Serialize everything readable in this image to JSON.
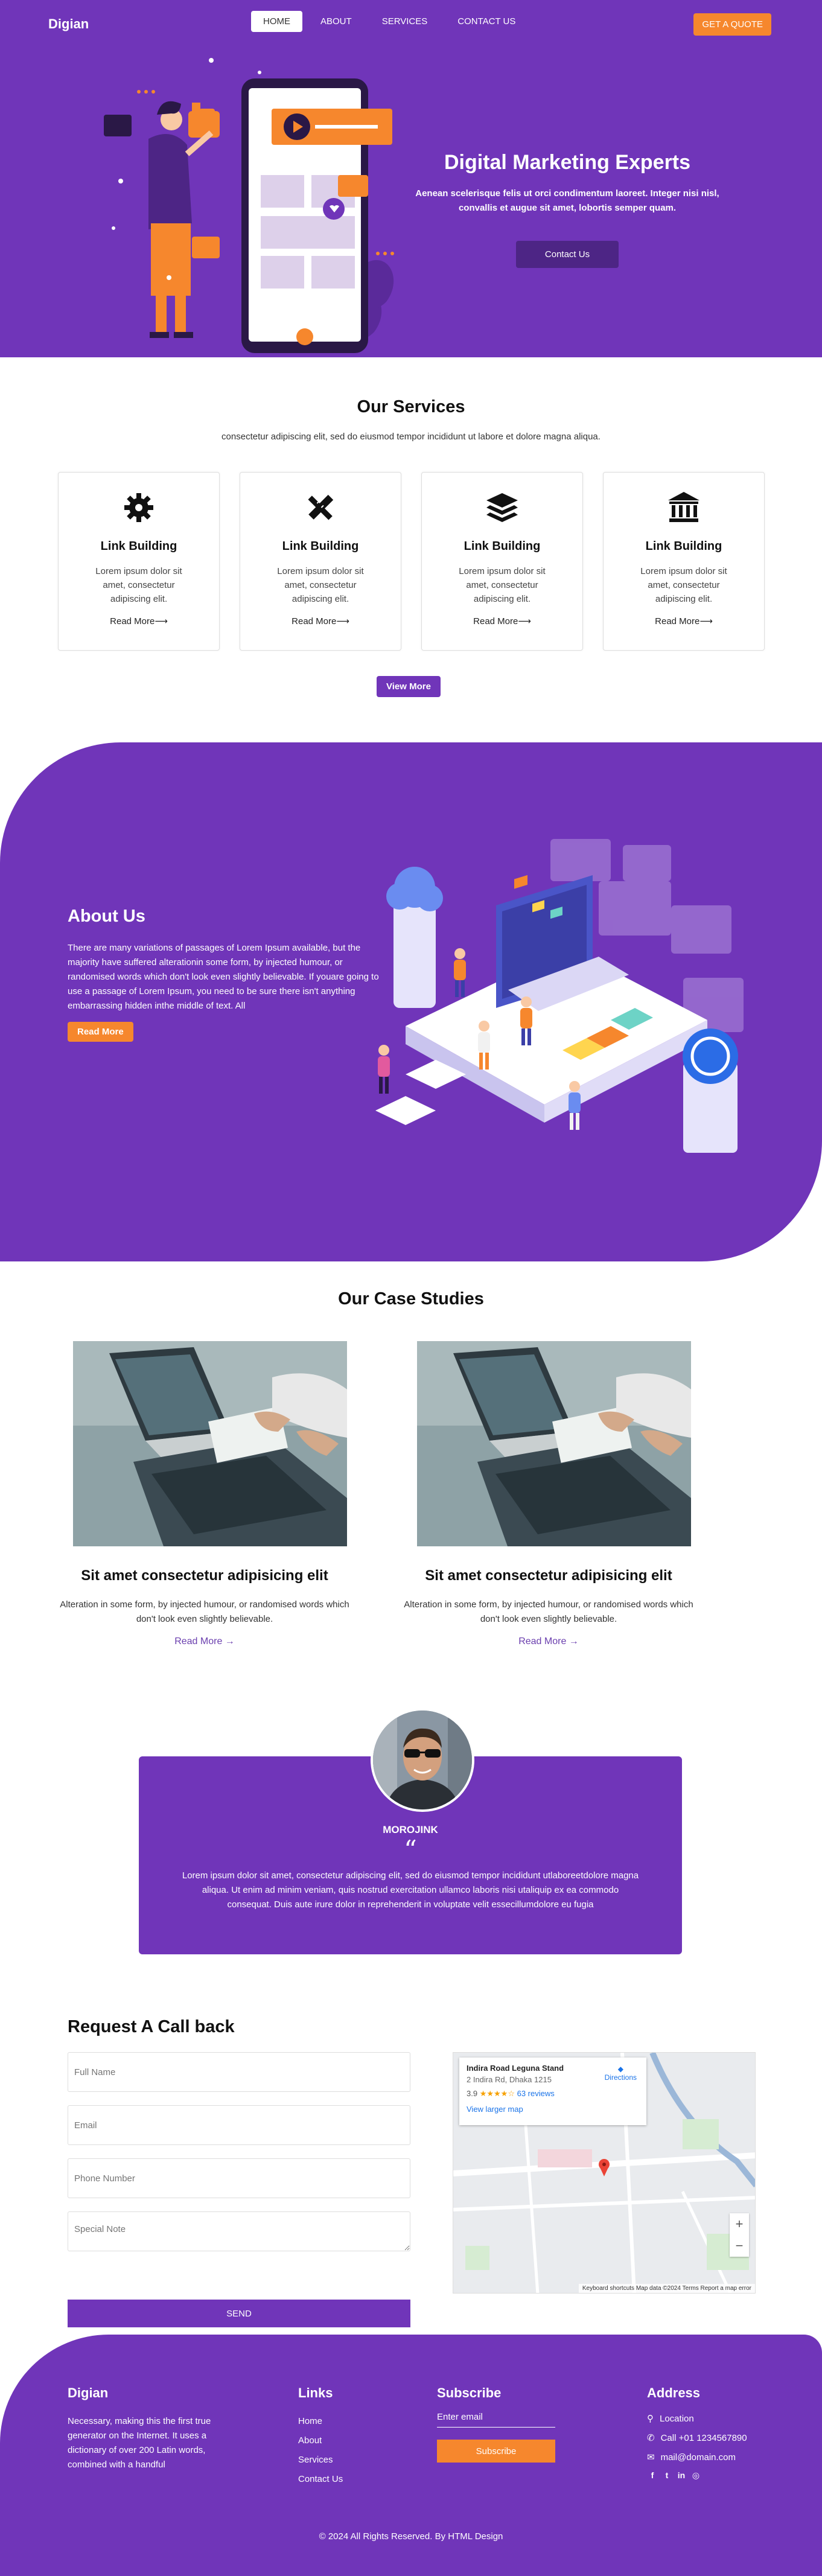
{
  "nav": {
    "brand": "Digian",
    "items": [
      "HOME",
      "ABOUT",
      "SERVICES",
      "CONTACT US"
    ],
    "active_index": 0,
    "quote_label": "GET A QUOTE"
  },
  "hero": {
    "title": "Digital Marketing Experts",
    "subtitle": "Aenean scelerisque felis ut orci condimentum laoreet. Integer nisi nisl, convallis et augue sit amet, lobortis semper quam.",
    "button": "Contact Us"
  },
  "services": {
    "title": "Our Services",
    "subtitle": "consectetur adipiscing elit, sed do eiusmod tempor incididunt ut labore et dolore magna aliqua.",
    "cards": [
      {
        "icon": "gear-icon",
        "title": "Link Building",
        "text": "Lorem ipsum dolor sit amet, consectetur adipiscing elit.",
        "more": "Read More"
      },
      {
        "icon": "pencil-ruler-icon",
        "title": "Link Building",
        "text": "Lorem ipsum dolor sit amet, consectetur adipiscing elit.",
        "more": "Read More"
      },
      {
        "icon": "layers-icon",
        "title": "Link Building",
        "text": "Lorem ipsum dolor sit amet, consectetur adipiscing elit.",
        "more": "Read More"
      },
      {
        "icon": "bank-icon",
        "title": "Link Building",
        "text": "Lorem ipsum dolor sit amet, consectetur adipiscing elit.",
        "more": "Read More"
      }
    ],
    "view_more": "View More"
  },
  "about": {
    "title": "About Us",
    "body": "There are many variations of passages of Lorem Ipsum available, but the majority have suffered alterationin some form, by injected humour, or randomised words which don't look even slightly believable. If youare going to use a passage of Lorem Ipsum, you need to be sure there isn't anything embarrassing hidden inthe middle of text. All",
    "button": "Read More"
  },
  "cases": {
    "title": "Our Case Studies",
    "items": [
      {
        "title": "Sit amet consectetur adipisicing elit",
        "text": "Alteration in some form, by injected humour, or randomised words which don't look even slightly believable.",
        "more": "Read More"
      },
      {
        "title": "Sit amet consectetur adipisicing elit",
        "text": "Alteration in some form, by injected humour, or randomised words which don't look even slightly believable.",
        "more": "Read More"
      }
    ]
  },
  "testimonial": {
    "name": "MOROJINK",
    "quote_mark": "“",
    "text": "Lorem ipsum dolor sit amet, consectetur adipiscing elit, sed do eiusmod tempor incididunt utlaboreetdolore magna aliqua. Ut enim ad minim veniam, quis nostrud exercitation ullamco laboris nisi utaliquip ex ea commodo consequat. Duis aute irure dolor in reprehenderit in voluptate velit essecillumdolore eu fugia"
  },
  "callback": {
    "title": "Request A Call back",
    "fields": {
      "name": "Full Name",
      "email": "Email",
      "phone": "Phone Number",
      "note": "Special Note"
    },
    "send": "SEND"
  },
  "map": {
    "place": "Indira Road Leguna Stand",
    "address": "2 Indira Rd, Dhaka 1215",
    "rating": "3.9",
    "stars": "★★★★☆",
    "reviews": "63 reviews",
    "larger": "View larger map",
    "directions": "Directions",
    "marker_label": "Indira Road Leguna Stand",
    "footer": "Keyboard shortcuts   Map data ©2024   Terms   Report a map error"
  },
  "footer": {
    "brand": "Digian",
    "brand_text": "Necessary, making this the first true generator on the Internet. It uses a dictionary of over 200 Latin words, combined with a handful",
    "links_title": "Links",
    "links": [
      "Home",
      "About",
      "Services",
      "Contact Us"
    ],
    "subscribe_title": "Subscribe",
    "email_placeholder": "Enter email",
    "subscribe_button": "Subscribe",
    "address_title": "Address",
    "location": "Location",
    "phone": "Call +01 1234567890",
    "mail": "mail@domain.com",
    "social": [
      "facebook-icon",
      "twitter-icon",
      "linkedin-icon",
      "instagram-icon"
    ],
    "copyright": "© 2024 All Rights Reserved. By HTML Design"
  },
  "colors": {
    "primary": "#7035b9",
    "accent": "#f6872d",
    "dark_button": "#4d2585"
  }
}
